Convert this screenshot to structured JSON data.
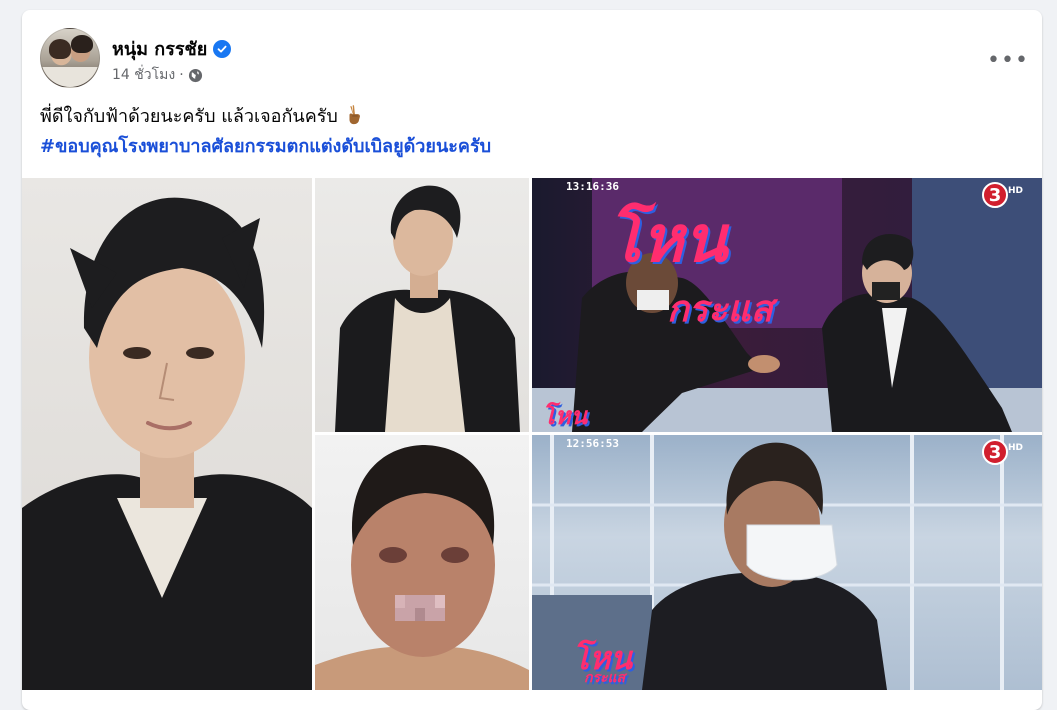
{
  "post": {
    "author": "หนุ่ม กรรชัย",
    "verified": true,
    "time": "14 ชั่วโมง",
    "separator": "·",
    "privacy_icon": "globe-icon",
    "more_label": "•••",
    "text_line": "พี่ดีใจกับฟ้าด้วยนะครับ แล้วเจอกันครับ",
    "emoji": "victory-hand",
    "hashtag": "#ขอบคุณโรงพยาบาลศัลยกรรมตกแต่งดับเบิลยูด้วยนะครับ"
  },
  "photos": {
    "tv_top": {
      "time": "13:16:36",
      "channel": "3",
      "hd": "HD",
      "logo_main": "โหน",
      "logo_sub": "กระแส"
    },
    "tv_bottom": {
      "time": "12:56:53",
      "channel": "3",
      "hd": "HD",
      "logo_main": "โหน",
      "logo_sub": "กระแส"
    }
  },
  "colors": {
    "link": "#1a4fd8",
    "verified": "#1877f2",
    "secondary_text": "#65676b",
    "channel_red": "#d11f2e"
  }
}
